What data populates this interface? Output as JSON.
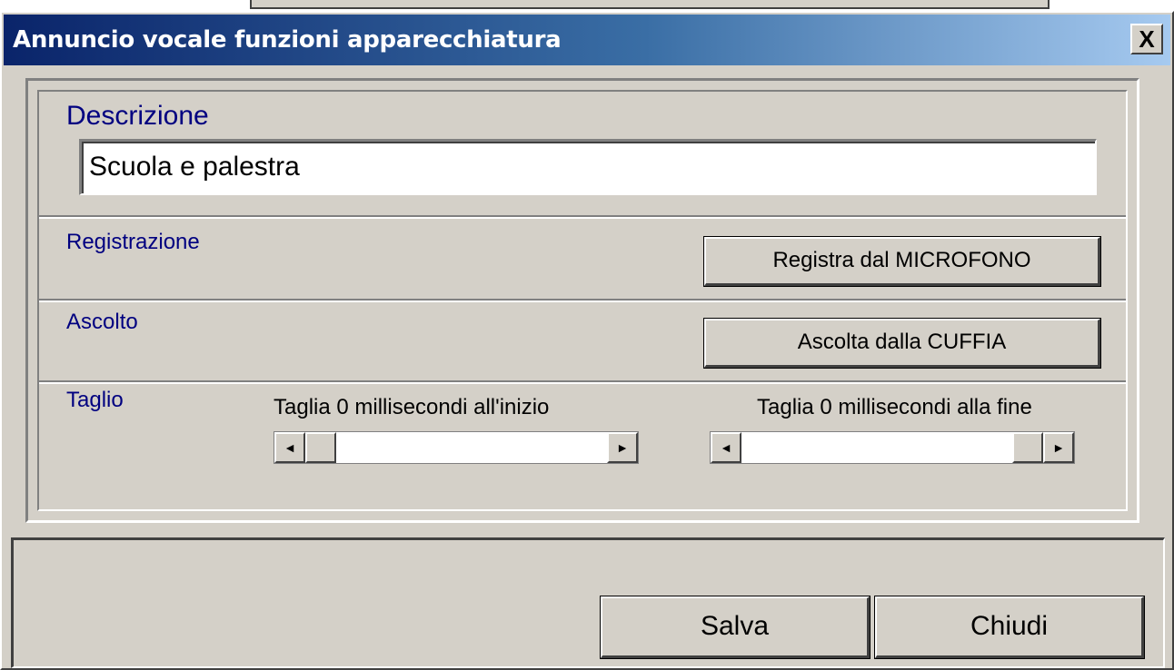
{
  "window": {
    "title": "Annuncio vocale funzioni apparecchiatura",
    "close_label": "X"
  },
  "descrizione": {
    "label": "Descrizione",
    "value": "Scuola e palestra"
  },
  "registrazione": {
    "label": "Registrazione",
    "button_label": "Registra dal MICROFONO"
  },
  "ascolto": {
    "label": "Ascolto",
    "button_label": "Ascolta dalla CUFFIA"
  },
  "taglio": {
    "label": "Taglio",
    "start_text": "Taglia 0 millisecondi all'inizio",
    "end_text": "Taglia 0 millisecondi alla fine",
    "start_position_fraction": 0.0,
    "end_position_fraction": 1.0,
    "arrow_left": "◄",
    "arrow_right": "►"
  },
  "footer": {
    "save_label": "Salva",
    "close_label": "Chiudi"
  }
}
